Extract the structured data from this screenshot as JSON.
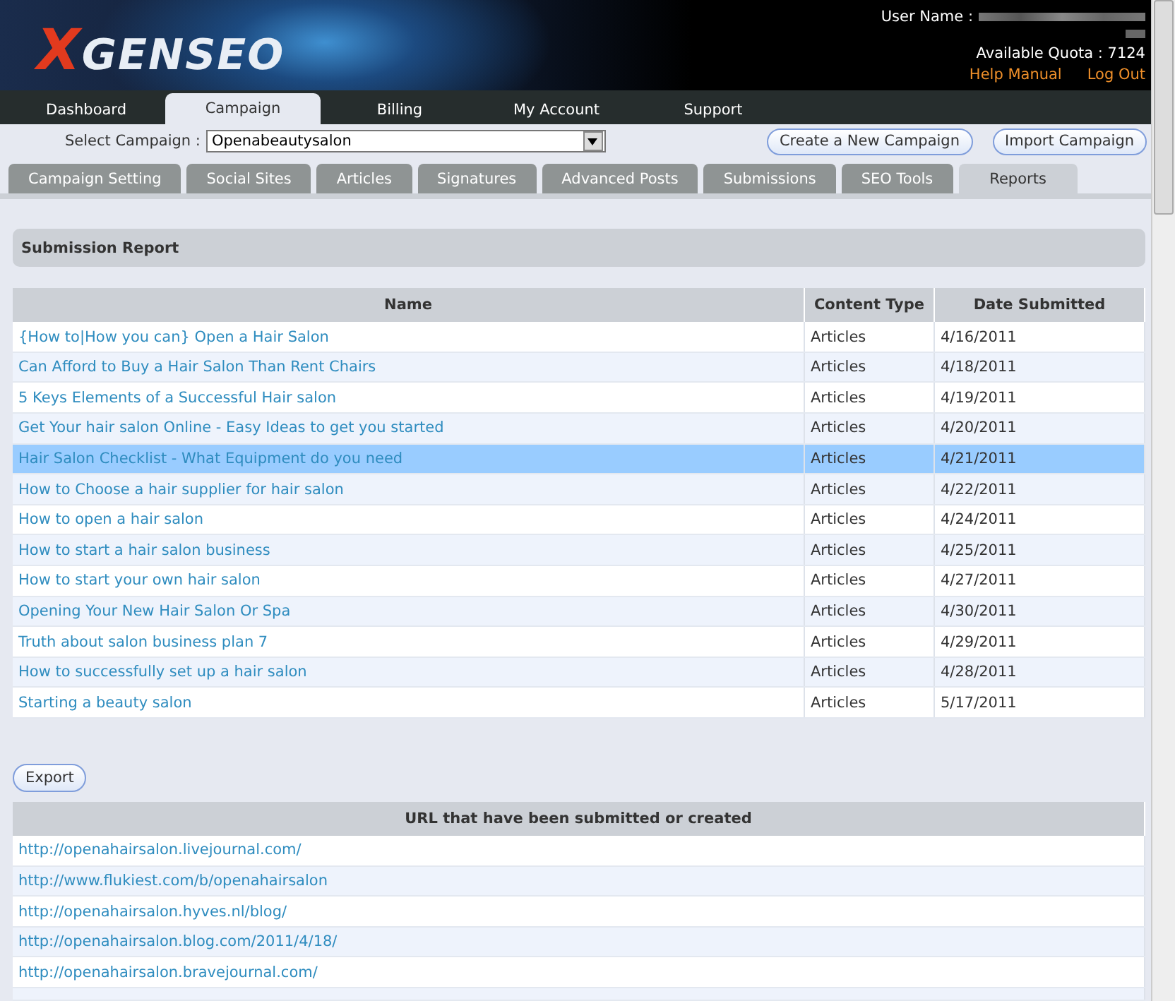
{
  "header": {
    "logo": {
      "mark": "X",
      "text": "GENSEO"
    },
    "user_label": "User Name :",
    "quota": "Available Quota : 7124",
    "links": [
      "Help Manual",
      "Log Out"
    ]
  },
  "nav": [
    {
      "label": "Dashboard",
      "selected": false
    },
    {
      "label": "Campaign",
      "selected": true
    },
    {
      "label": "Billing",
      "selected": false
    },
    {
      "label": "My Account",
      "selected": false
    },
    {
      "label": "Support",
      "selected": false
    }
  ],
  "campaign_bar": {
    "label": "Select Campaign :",
    "value": "Openabeautysalon",
    "buttons": [
      "Create a New Campaign",
      "Import Campaign"
    ]
  },
  "subtabs": [
    {
      "label": "Campaign Setting",
      "selected": false
    },
    {
      "label": "Social Sites",
      "selected": false
    },
    {
      "label": "Articles",
      "selected": false
    },
    {
      "label": "Signatures",
      "selected": false
    },
    {
      "label": "Advanced Posts",
      "selected": false
    },
    {
      "label": "Submissions",
      "selected": false
    },
    {
      "label": "SEO Tools",
      "selected": false
    },
    {
      "label": "Reports",
      "selected": true
    }
  ],
  "section_title": "Submission Report",
  "table": {
    "columns": [
      "Name",
      "Content Type",
      "Date Submitted"
    ],
    "rows": [
      {
        "name": "{How to|How you can} Open a Hair Salon",
        "type": "Articles",
        "date": "4/16/2011",
        "selected": false
      },
      {
        "name": "Can Afford to Buy a Hair Salon Than Rent Chairs",
        "type": "Articles",
        "date": "4/18/2011",
        "selected": false
      },
      {
        "name": "5 Keys Elements of a Successful Hair salon",
        "type": "Articles",
        "date": "4/19/2011",
        "selected": false
      },
      {
        "name": "Get Your hair salon Online - Easy Ideas to get you started",
        "type": "Articles",
        "date": "4/20/2011",
        "selected": false
      },
      {
        "name": "Hair Salon Checklist - What Equipment do you need",
        "type": "Articles",
        "date": "4/21/2011",
        "selected": true
      },
      {
        "name": "How to Choose a hair supplier for hair salon",
        "type": "Articles",
        "date": "4/22/2011",
        "selected": false
      },
      {
        "name": "How to open a hair salon",
        "type": "Articles",
        "date": "4/24/2011",
        "selected": false
      },
      {
        "name": "How to start a hair salon business",
        "type": "Articles",
        "date": "4/25/2011",
        "selected": false
      },
      {
        "name": "How to start your own hair salon",
        "type": "Articles",
        "date": "4/27/2011",
        "selected": false
      },
      {
        "name": "Opening Your New Hair Salon Or Spa",
        "type": "Articles",
        "date": "4/30/2011",
        "selected": false
      },
      {
        "name": "Truth about salon business plan 7",
        "type": "Articles",
        "date": "4/29/2011",
        "selected": false
      },
      {
        "name": "How to successfully set up a hair salon",
        "type": "Articles",
        "date": "4/28/2011",
        "selected": false
      },
      {
        "name": "Starting a beauty salon",
        "type": "Articles",
        "date": "5/17/2011",
        "selected": false
      }
    ]
  },
  "export_button": "Export",
  "url_table": {
    "column": "URL that have been submitted or created",
    "rows": [
      "http://openahairsalon.livejournal.com/",
      "http://www.flukiest.com/b/openahairsalon",
      "http://openahairsalon.hyves.nl/blog/",
      "http://openahairsalon.blog.com/2011/4/18/",
      "http://openahairsalon.bravejournal.com/"
    ]
  }
}
